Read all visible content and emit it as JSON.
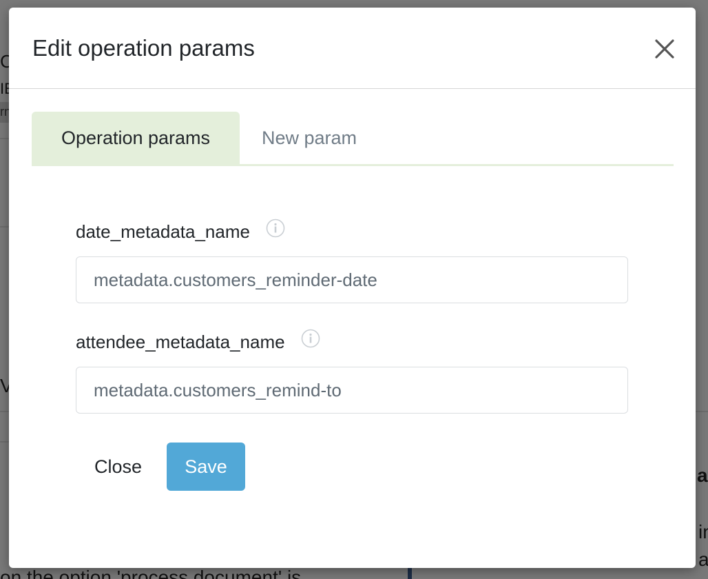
{
  "background": {
    "fragments": {
      "c": "C",
      "ie": "IE",
      "rm": "rn",
      "v": "V",
      "at": "at",
      "in": "in",
      "a": "a",
      "bottom": "on the option 'process document' is"
    }
  },
  "modal": {
    "title": "Edit operation params",
    "close_icon": "close-icon"
  },
  "tabs": [
    {
      "label": "Operation params",
      "active": true
    },
    {
      "label": "New param",
      "active": false
    }
  ],
  "fields": [
    {
      "label": "date_metadata_name",
      "value": "metadata.customers_reminder-date",
      "info_icon": "info-icon"
    },
    {
      "label": "attendee_metadata_name",
      "value": "metadata.customers_remind-to",
      "info_icon": "info-icon"
    }
  ],
  "footer": {
    "close_label": "Close",
    "save_label": "Save"
  },
  "colors": {
    "tab_active_bg": "#e4efdb",
    "save_button": "#52a8d7",
    "overlay": "rgba(0,0,0,0.5)"
  }
}
